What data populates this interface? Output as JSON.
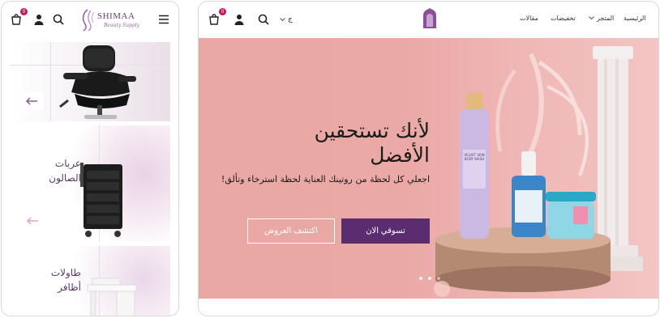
{
  "mobile": {
    "header": {
      "cart_count": "0",
      "brand": "SHIMAA",
      "tagline": "Beauty Supply"
    },
    "cards": [
      {
        "title": ""
      },
      {
        "title": "عربات الصالون"
      },
      {
        "title": "طاولات أظافر"
      }
    ]
  },
  "desktop": {
    "header": {
      "cart_count": "0",
      "currency": "ج",
      "nav": [
        {
          "label": "الرئيسية"
        },
        {
          "label": "المتجر"
        },
        {
          "label": "تخفيضات"
        },
        {
          "label": "مقالات"
        }
      ]
    },
    "hero": {
      "title_line1": "لأنك تستحقين",
      "title_line2": "الأفضل",
      "subtitle": "اجعلي كل لحظة من روتينك العناية لحظة استرخاء وتألق!",
      "shop_now": "تسوقي الان",
      "discover_offers": "اكتشف العروض",
      "product_label_line1": "VELVET SKIN",
      "product_label_line2": "BODY WASH",
      "slides": 3,
      "active_slide": 1
    }
  },
  "colors": {
    "brand_purple": "#5b2c6f",
    "hero_pink": "#eaa9a6",
    "badge": "#c2185b"
  }
}
